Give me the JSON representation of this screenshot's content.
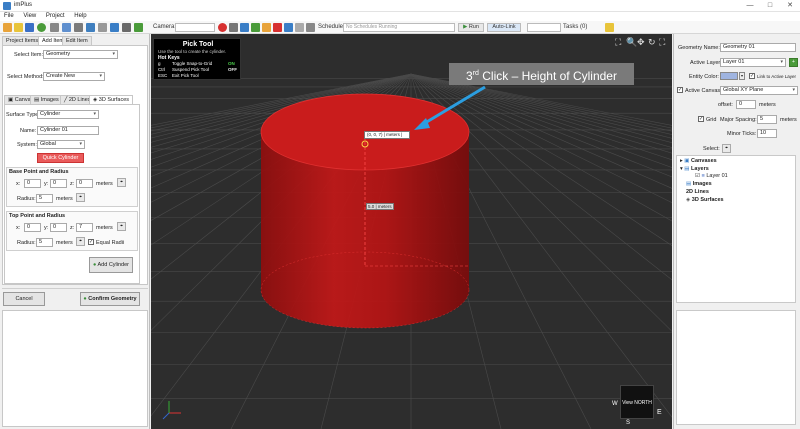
{
  "window": {
    "title": "imPlus",
    "minimize": "—",
    "maximize": "□",
    "close": "✕"
  },
  "menu": [
    "File",
    "View",
    "Project",
    "Help"
  ],
  "toolbar": {
    "camera_label": "Camera:",
    "schedule_label": "Schedule:",
    "schedule_placeholder": "No Schedules Running",
    "run_label": "Run",
    "autolink_label": "Auto-Link",
    "tasks_label": "Tasks (0)"
  },
  "left": {
    "tabs": [
      "Project Items",
      "Add Item",
      "Edit Item"
    ],
    "select_item_label": "Select Item:",
    "select_item_value": "Geometry",
    "select_method_label": "Select Method:",
    "select_method_value": "Create New",
    "subtabs": [
      "Canvas",
      "Images",
      "2D Lines",
      "3D Surfaces"
    ],
    "surface_type_label": "Surface Type:",
    "surface_type_value": "Cylinder",
    "name_label": "Name:",
    "name_value": "Cylinder 01",
    "system_label": "System:",
    "system_value": "Global",
    "quick_cylinder": "Quick Cylinder",
    "base_title": "Base Point and Radius",
    "top_title": "Top Point and Radius",
    "x_label": "x:",
    "y_label": "y:",
    "z_label": "z:",
    "meters": "meters",
    "radius_label": "Radius:",
    "base_x": "0",
    "base_y": "0",
    "base_z": "0",
    "base_radius": "5",
    "top_x": "0",
    "top_y": "0",
    "top_z": "7",
    "top_radius": "5",
    "equal_radii": "Equal Radii",
    "add_cylinder": "Add Cylinder",
    "cancel": "Cancel",
    "confirm": "Confirm Geometry"
  },
  "viewport": {
    "pick_title": "Pick Tool",
    "pick_desc": "Use the tool to create the cylinder.",
    "hot_keys": "Hot Keys",
    "keys": [
      {
        "key": "g",
        "action": "Toggle Snap-to-Grid",
        "state": "ON"
      },
      {
        "key": "Ctrl",
        "action": "Suspend Pick Tool",
        "state": "OFF"
      },
      {
        "key": "ESC",
        "action": "Exit Pick Tool",
        "state": ""
      }
    ],
    "callout_text": "3rd Click – Height of Cylinder",
    "coord_readout": "(0, 0, 7) | meters |",
    "coord_readout2": "5.0 | meters",
    "viewcube_label": "View NORTH",
    "compass_e": "E",
    "compass_s": "S",
    "compass_w": "W"
  },
  "right": {
    "geometry_name_label": "Geometry Name:",
    "geometry_name_value": "Geometry 01",
    "active_layer_label": "Active Layer:",
    "active_layer_value": "Layer 01",
    "entity_color_label": "Entity Color:",
    "link_active_layer": "Link to Active Layer",
    "active_canvas_label": "Active Canvas:",
    "active_canvas_value": "Global XY Plane",
    "offset_label": "offset:",
    "offset_value": "0",
    "grid_label": "Grid",
    "major_spacing_label": "Major Spacing:",
    "major_spacing_value": "5",
    "minor_ticks_label": "Minor Ticks:",
    "minor_ticks_value": "10",
    "select_label": "Select:",
    "meters": "meters",
    "tree": [
      "Canvases",
      "Layers",
      "Layer 01",
      "Images",
      "2D Lines",
      "3D Surfaces"
    ]
  },
  "colors": {
    "accent_red": "#d73030",
    "cylinder": "#b31414",
    "viewport_bg": "#2d2d2d"
  }
}
